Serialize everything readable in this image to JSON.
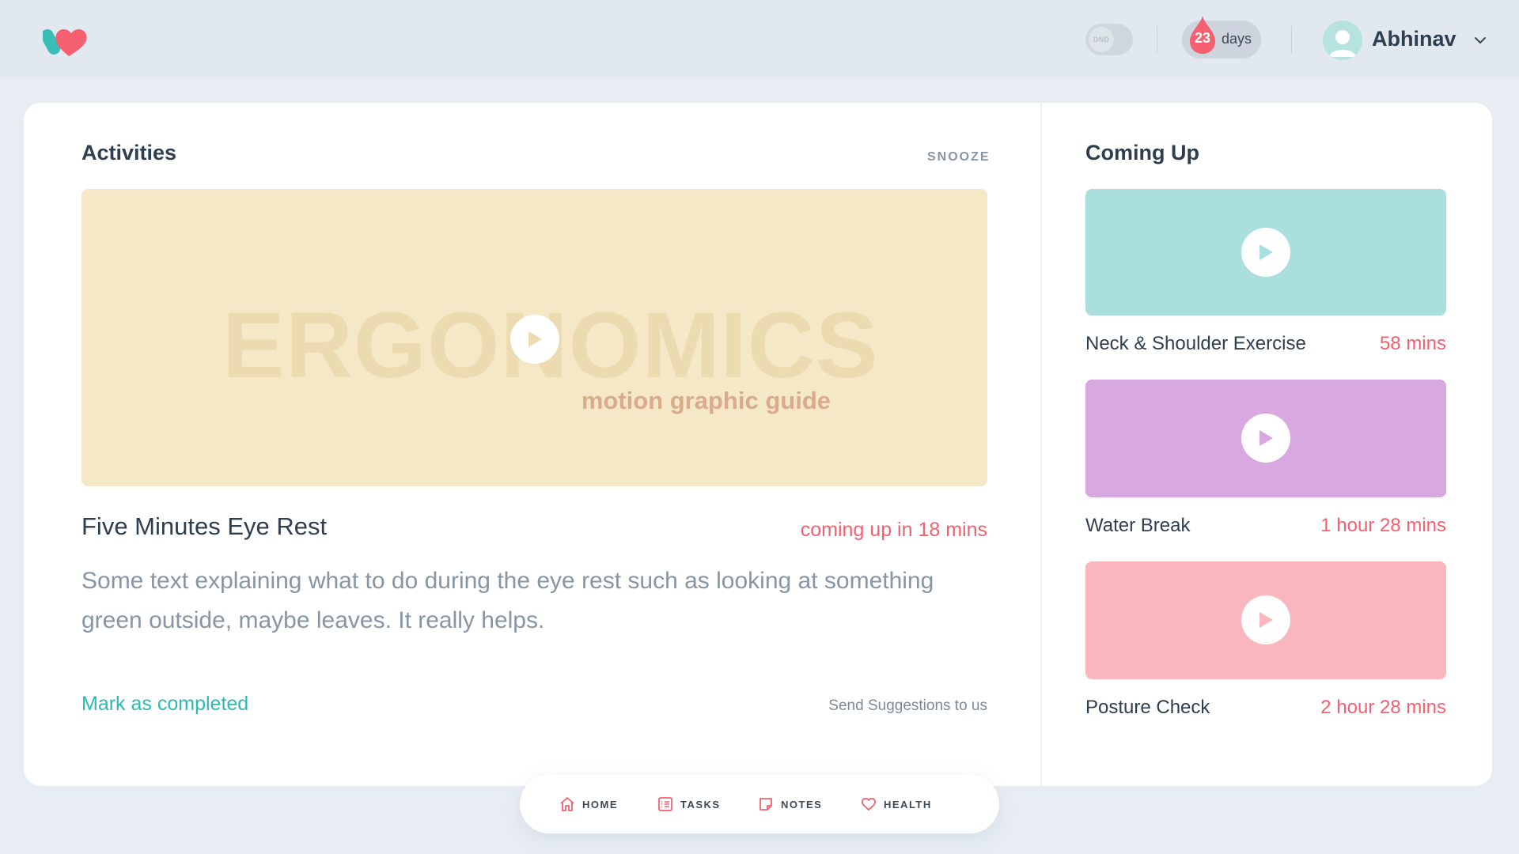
{
  "header": {
    "dnd_label": "DND",
    "streak_count": "23",
    "streak_label": "days",
    "username": "Abhinav"
  },
  "activities": {
    "title": "Activities",
    "snooze_label": "SNOOZE",
    "hero_title": "ERGONOMICS",
    "hero_subtitle": "motion graphic guide",
    "activity_name": "Five Minutes Eye Rest",
    "activity_time": "coming up in 18 mins",
    "description": "Some text explaining what to do during the eye rest such as looking at something green outside, maybe leaves. It really helps.",
    "mark_completed": "Mark as completed",
    "send_suggestions": "Send Suggestions to us"
  },
  "coming_up": {
    "title": "Coming Up",
    "items": [
      {
        "name": "Neck & Shoulder Exercise",
        "time": "58 mins",
        "color": "#a9dfdd"
      },
      {
        "name": "Water Break",
        "time": "1 hour 28 mins",
        "color": "#d8a8e0"
      },
      {
        "name": "Posture Check",
        "time": "2 hour 28 mins",
        "color": "#fbb7c0"
      }
    ]
  },
  "nav": {
    "items": [
      {
        "label": "HOME",
        "icon": "home-icon"
      },
      {
        "label": "TASKS",
        "icon": "tasks-icon"
      },
      {
        "label": "NOTES",
        "icon": "notes-icon"
      },
      {
        "label": "HEALTH",
        "icon": "heart-icon"
      }
    ]
  },
  "colors": {
    "accent_red": "#f4606f",
    "accent_teal": "#2fb9b5",
    "background": "#e8edf3"
  }
}
